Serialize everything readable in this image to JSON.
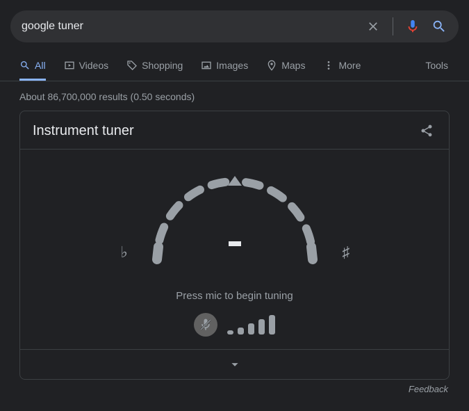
{
  "search": {
    "query": "google tuner"
  },
  "tabs": {
    "all": "All",
    "videos": "Videos",
    "shopping": "Shopping",
    "images": "Images",
    "maps": "Maps",
    "more": "More",
    "tools": "Tools"
  },
  "results_stats": "About 86,700,000 results (0.50 seconds)",
  "tuner": {
    "title": "Instrument tuner",
    "flat_symbol": "♭",
    "sharp_symbol": "♯",
    "prompt": "Press mic to begin tuning"
  },
  "feedback": "Feedback"
}
